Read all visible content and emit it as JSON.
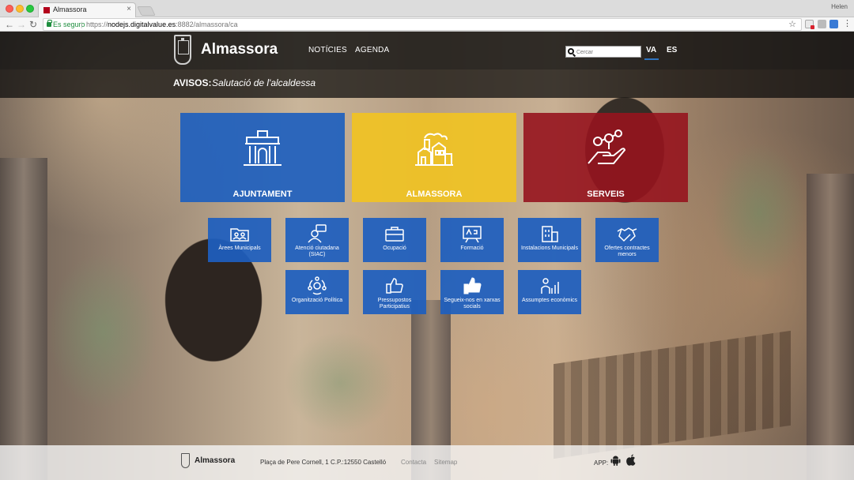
{
  "browser": {
    "tab_title": "Almassora",
    "user": "Helen",
    "secure_label": "Es seguro",
    "url_scheme": "https://",
    "url_host": "nodejs.digitalvalue.es",
    "url_rest": ":8882/almassora/ca"
  },
  "header": {
    "site_title": "Almassora",
    "nav": [
      "NOTÍCIES",
      "AGENDA"
    ],
    "search_placeholder": "Cercar",
    "languages": [
      "VA",
      "ES"
    ],
    "active_language": "VA"
  },
  "avisos": {
    "label": "AVISOS:",
    "text": "Salutació de l'alcaldessa"
  },
  "big_tiles": [
    {
      "label": "AJUNTAMENT",
      "icon": "town-hall-icon",
      "color": "#1e5fbe"
    },
    {
      "label": "ALMASSORA",
      "icon": "town-houses-icon",
      "color": "#f0c323"
    },
    {
      "label": "SERVEIS",
      "icon": "hand-network-icon",
      "color": "#96141e"
    }
  ],
  "small_tiles": [
    {
      "label": "Àrees Municipals",
      "icon": "folder-people-icon"
    },
    {
      "label": "Atenció ciutadana (SIAC)",
      "icon": "person-help-icon"
    },
    {
      "label": "Ocupació",
      "icon": "briefcase-icon"
    },
    {
      "label": "Formació",
      "icon": "blackboard-icon"
    },
    {
      "label": "Instalacions Municipals",
      "icon": "building-icon"
    },
    {
      "label": "Ofertes contractes menors",
      "icon": "handshake-icon"
    },
    {
      "label": "Organització Política",
      "icon": "people-cycle-icon"
    },
    {
      "label": "Pressupostos Participatius",
      "icon": "thumbs-up-icon"
    },
    {
      "label": "Segueix-nos en xarxas socials",
      "icon": "like-icon"
    },
    {
      "label": "Assumptes econòmics",
      "icon": "person-chart-icon"
    }
  ],
  "footer": {
    "name": "Almassora",
    "address": "Plaça de Pere Cornell, 1 C.P.:12550 Castelló",
    "links": [
      "Contacta",
      "Sitemap"
    ],
    "app_label": "APP:"
  }
}
